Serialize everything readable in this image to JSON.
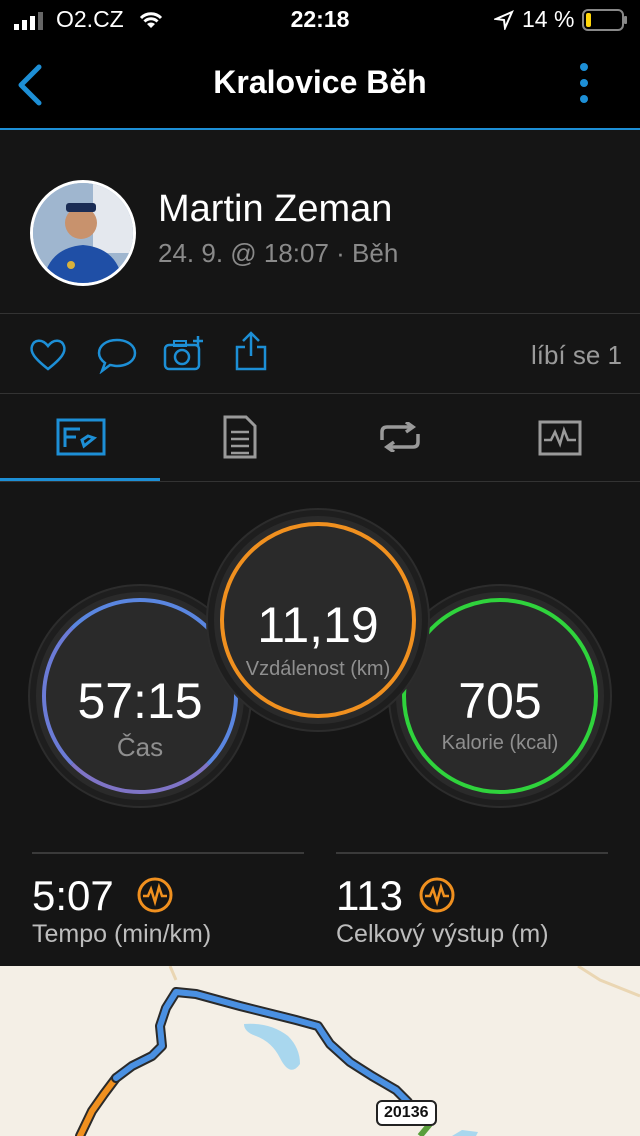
{
  "status": {
    "carrier": "O2.CZ",
    "time": "22:18",
    "battery": "14 %"
  },
  "nav": {
    "title": "Kralovice Běh"
  },
  "profile": {
    "name": "Martin Zeman",
    "meta": "24. 9. @ 18:07 · Běh"
  },
  "social": {
    "likes": "líbí se 1"
  },
  "tabs": [
    "overview-icon",
    "details-icon",
    "laps-icon",
    "graphs-icon"
  ],
  "summary": {
    "time": {
      "value": "57:15",
      "label": "Čas",
      "color": "#4a8fe0"
    },
    "distance": {
      "value": "11,19",
      "label": "Vzdálenost (km)",
      "color": "#f0901f"
    },
    "calories": {
      "value": "705",
      "label": "Kalorie (kcal)",
      "color": "#2fd33c"
    }
  },
  "stats": {
    "pace": {
      "value": "5:07",
      "label": "Tempo (min/km)"
    },
    "elevation": {
      "value": "113",
      "label": "Celkový výstup (m)"
    }
  },
  "map": {
    "road_label": "20136"
  },
  "colors": {
    "accent": "#1d8fd6",
    "orange": "#f0901f"
  }
}
